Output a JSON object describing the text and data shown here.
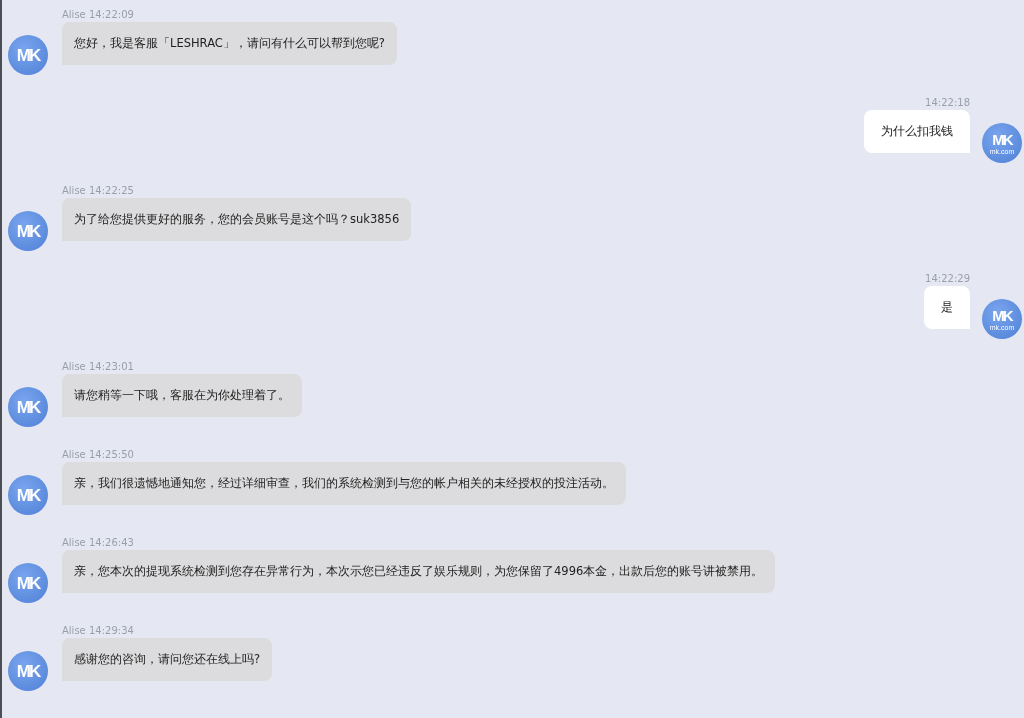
{
  "messages": [
    {
      "kind": "incoming",
      "sender": "Alise",
      "time": "14:22:09",
      "text": "您好，我是客服「LESHRAC」，请问有什么可以帮到您呢?",
      "avatar": {
        "logo": "MK"
      }
    },
    {
      "kind": "outgoing",
      "time": "14:22:18",
      "text": "为什么扣我钱",
      "avatar": {
        "logo": "MK",
        "caption": "mk.com"
      }
    },
    {
      "kind": "incoming",
      "sender": "Alise",
      "time": "14:22:25",
      "text": "为了给您提供更好的服务，您的会员账号是这个吗？suk3856",
      "avatar": {
        "logo": "MK"
      }
    },
    {
      "kind": "outgoing",
      "time": "14:22:29",
      "text": "是",
      "avatar": {
        "logo": "MK",
        "caption": "mk.com"
      }
    },
    {
      "kind": "incoming",
      "sender": "Alise",
      "time": "14:23:01",
      "text": "请您稍等一下哦，客服在为你处理着了。",
      "avatar": {
        "logo": "MK"
      }
    },
    {
      "kind": "incoming",
      "sender": "Alise",
      "time": "14:25:50",
      "text": "亲，我们很遗憾地通知您，经过详细审查，我们的系统检测到与您的帐户相关的未经授权的投注活动。",
      "avatar": {
        "logo": "MK"
      }
    },
    {
      "kind": "incoming",
      "sender": "Alise",
      "time": "14:26:43",
      "text": "亲，您本次的提现系统检测到您存在异常行为，本次示您已经违反了娱乐规则，为您保留了4996本金，出款后您的账号讲被禁用。",
      "avatar": {
        "logo": "MK"
      }
    },
    {
      "kind": "incoming",
      "sender": "Alise",
      "time": "14:29:34",
      "text": "感谢您的咨询，请问您还在线上吗?",
      "avatar": {
        "logo": "MK"
      }
    }
  ]
}
